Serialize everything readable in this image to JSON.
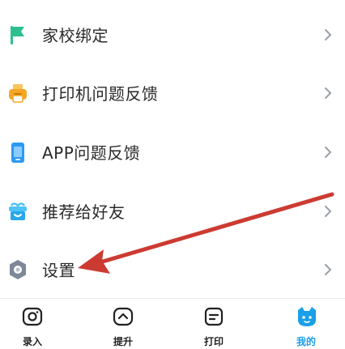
{
  "menu": {
    "items": [
      {
        "label": "家校绑定",
        "icon": "flag-icon"
      },
      {
        "label": "打印机问题反馈",
        "icon": "printer-icon"
      },
      {
        "label": "APP问题反馈",
        "icon": "phone-icon"
      },
      {
        "label": "推荐给好友",
        "icon": "gift-box-icon"
      },
      {
        "label": "设置",
        "icon": "settings-hexagon-icon"
      }
    ]
  },
  "tabbar": {
    "tabs": [
      {
        "label": "录入",
        "icon": "camera-icon",
        "active": false
      },
      {
        "label": "提升",
        "icon": "arrow-up-icon",
        "active": false
      },
      {
        "label": "打印",
        "icon": "print-icon",
        "active": false
      },
      {
        "label": "我的",
        "icon": "cat-face-icon",
        "active": true
      }
    ]
  },
  "colors": {
    "accent": "#1aa0e8",
    "flag": "#2fbf8f",
    "printer": "#f5a623",
    "phone": "#2b9af3",
    "gift": "#4fc3f7",
    "settings": "#7d8899",
    "annotation_arrow": "#cc3b32"
  }
}
